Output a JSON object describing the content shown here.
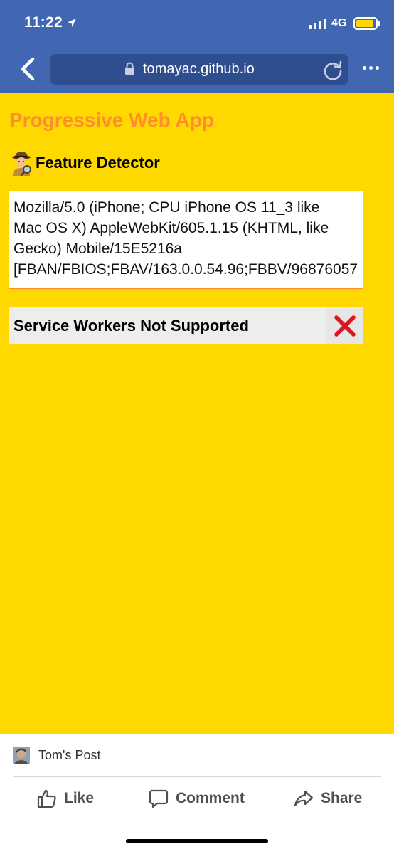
{
  "status_bar": {
    "time": "11:22",
    "network": "4G",
    "icons": [
      "location-arrow-icon",
      "signal-icon",
      "battery-icon"
    ],
    "battery_color": "#ffd800"
  },
  "browser": {
    "url": "tomayac.github.io",
    "header_color": "#4267b2",
    "urlbar_color": "#2f4e8f",
    "icons": [
      "back-chevron-icon",
      "lock-icon",
      "reload-icon",
      "more-icon"
    ]
  },
  "page": {
    "background": "#ffd800",
    "accent": "#ff8c2e",
    "title": "Progressive Web App",
    "heading": "Feature Detector",
    "heading_icon": "detective-emoji-icon",
    "user_agent_lines": [
      "Mozilla/5.0 (iPhone; CPU iPhone OS 11_3 like",
      "Mac OS X) AppleWebKit/605.1.15 (KHTML, like",
      "Gecko) Mobile/15E5216a",
      "[FBAN/FBIOS;FBAV/163.0.0.54.96;FBBV/96876057"
    ],
    "feature": {
      "label": "Service Workers Not Supported",
      "status_icon": "cross-mark-icon",
      "status_color": "#e0141e"
    }
  },
  "facebook_bar": {
    "post_label": "Tom's Post",
    "actions": [
      {
        "label": "Like",
        "icon": "thumbs-up-icon"
      },
      {
        "label": "Comment",
        "icon": "comment-icon"
      },
      {
        "label": "Share",
        "icon": "share-icon"
      }
    ]
  }
}
